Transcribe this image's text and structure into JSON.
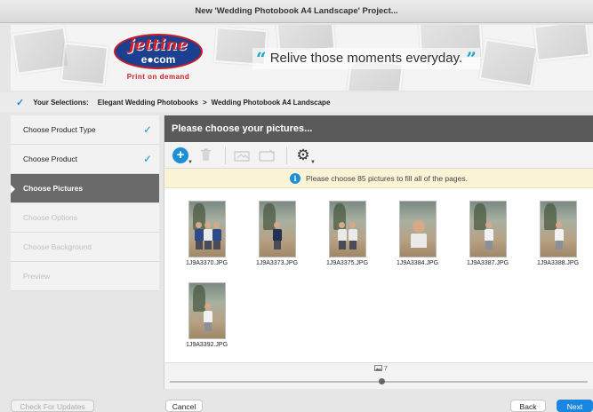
{
  "window": {
    "title": "New 'Wedding Photobook A4 Landscape' Project..."
  },
  "banner": {
    "logo_word": "jettine",
    "logo_com": "e●com",
    "logo_sub": "Print on demand",
    "quote_open": "“",
    "tagline": "Relive those moments everyday.",
    "quote_close": "”"
  },
  "selections": {
    "label": "Your Selections:",
    "category": "Elegant Wedding Photobooks",
    "separator": ">",
    "product": "Wedding Photobook A4 Landscape"
  },
  "sidebar": {
    "items": [
      {
        "label": "Choose Product Type",
        "state": "done"
      },
      {
        "label": "Choose Product",
        "state": "done"
      },
      {
        "label": "Choose Pictures",
        "state": "active"
      },
      {
        "label": "Choose Options",
        "state": "disabled"
      },
      {
        "label": "Choose Background",
        "state": "disabled"
      },
      {
        "label": "Preview",
        "state": "disabled"
      }
    ]
  },
  "main": {
    "header": "Please choose your pictures...",
    "info": "Please choose 85 pictures to fill all of the pages.",
    "photo_count": "7",
    "zoom_fraction": 0.5
  },
  "photos": [
    {
      "name": "1J9A3370.JPG"
    },
    {
      "name": "1J9A3373.JPG"
    },
    {
      "name": "1J9A3375.JPG"
    },
    {
      "name": "1J9A3384.JPG"
    },
    {
      "name": "1J9A3387.JPG"
    },
    {
      "name": "1J9A3388.JPG"
    },
    {
      "name": "1J9A3392.JPG"
    }
  ],
  "footer": {
    "check_updates": "Check For Updates",
    "cancel": "Cancel",
    "back": "Back",
    "next": "Next"
  },
  "colors": {
    "accent": "#1d8fd6",
    "header": "#5a5a5a",
    "info_bg": "#fbf3d6",
    "logo_red": "#d41f2a",
    "logo_blue": "#1c3f8f"
  }
}
